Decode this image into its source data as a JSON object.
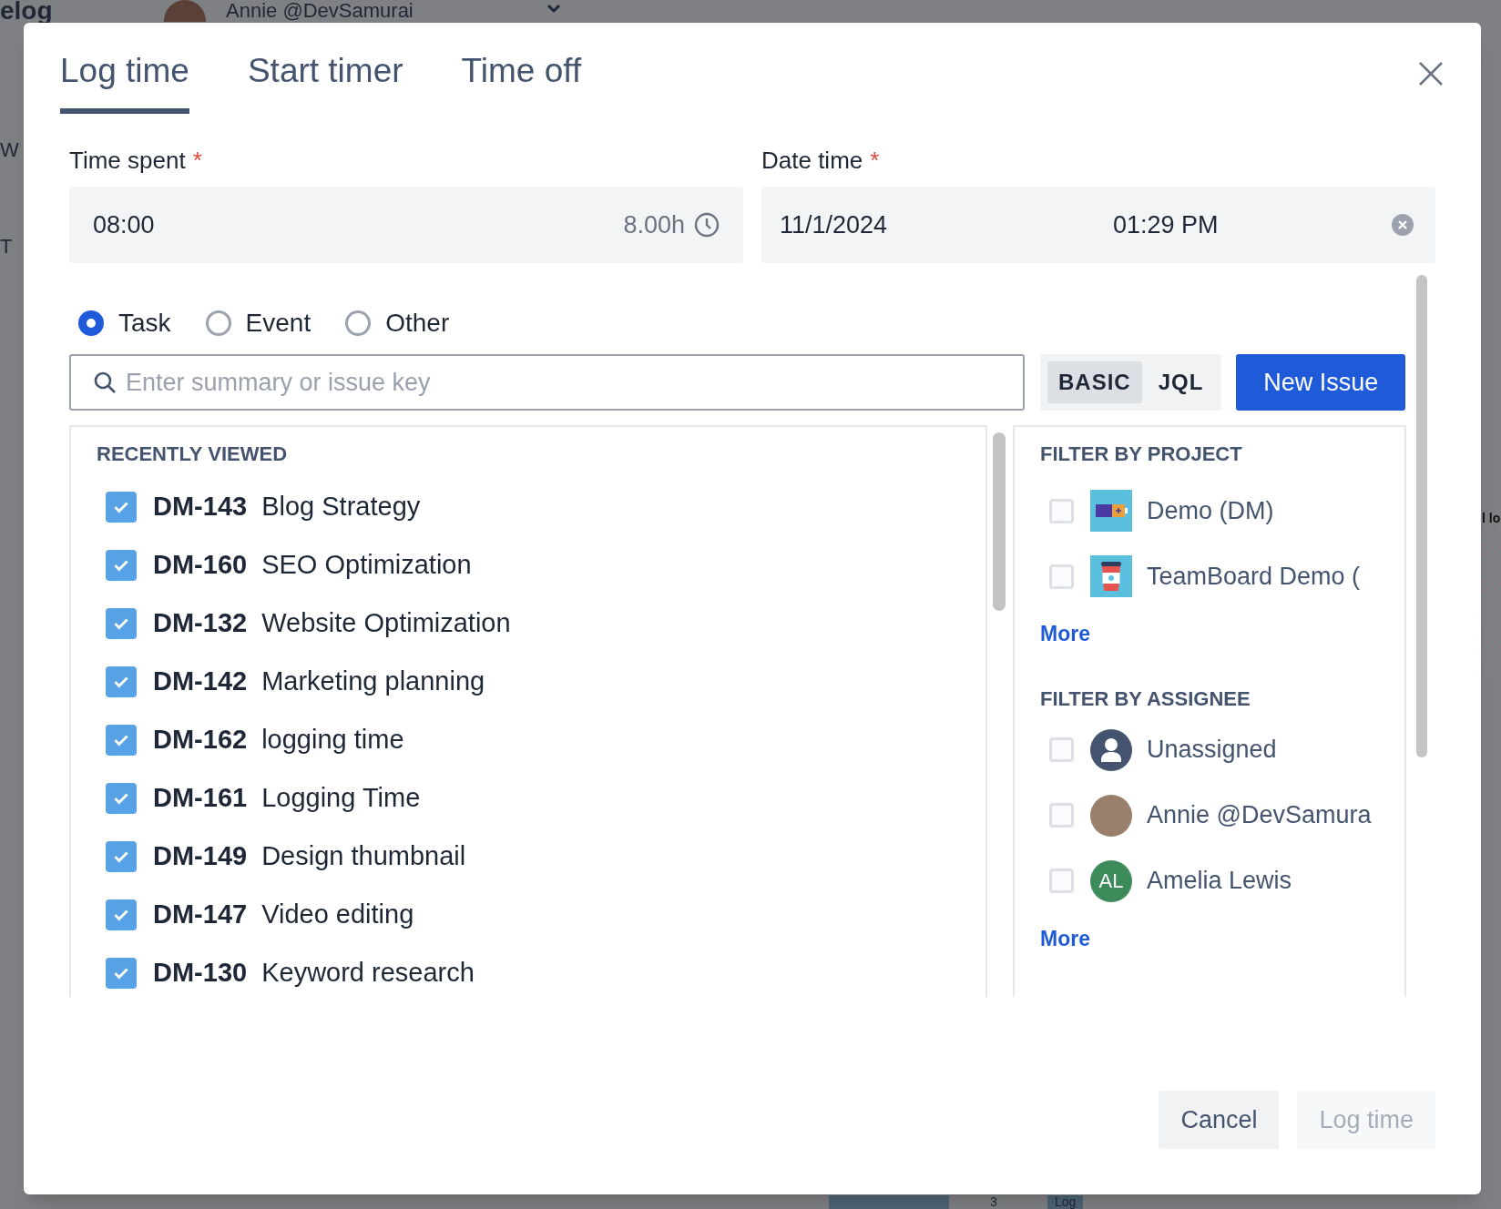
{
  "background": {
    "app_title": "elog",
    "user": "Annie @DevSamurai",
    "left_fragments": [
      "W",
      "T"
    ],
    "right_fragment": "l lo",
    "bottom_fragments": [
      "3",
      "Log"
    ]
  },
  "tabs": [
    {
      "label": "Log time",
      "selected": true
    },
    {
      "label": "Start timer",
      "selected": false
    },
    {
      "label": "Time off",
      "selected": false
    }
  ],
  "fields": {
    "time_spent": {
      "label": "Time spent",
      "required_mark": "*",
      "value": "08:00",
      "hint": "8.00h"
    },
    "date_time": {
      "label": "Date time",
      "required_mark": "*",
      "date": "11/1/2024",
      "time": "01:29 PM"
    }
  },
  "types": [
    {
      "label": "Task",
      "selected": true
    },
    {
      "label": "Event",
      "selected": false
    },
    {
      "label": "Other",
      "selected": false
    }
  ],
  "search": {
    "placeholder": "Enter summary or issue key"
  },
  "modes": [
    {
      "label": "BASIC",
      "selected": true
    },
    {
      "label": "JQL",
      "selected": false
    }
  ],
  "new_issue_button": "New Issue",
  "recently_viewed": {
    "heading": "RECENTLY VIEWED",
    "items": [
      {
        "key": "DM-143",
        "summary": "Blog Strategy",
        "checked": true
      },
      {
        "key": "DM-160",
        "summary": "SEO Optimization",
        "checked": true
      },
      {
        "key": "DM-132",
        "summary": "Website Optimization",
        "checked": true
      },
      {
        "key": "DM-142",
        "summary": "Marketing planning",
        "checked": true
      },
      {
        "key": "DM-162",
        "summary": "logging time",
        "checked": true
      },
      {
        "key": "DM-161",
        "summary": "Logging Time",
        "checked": true
      },
      {
        "key": "DM-149",
        "summary": "Design thumbnail",
        "checked": true
      },
      {
        "key": "DM-147",
        "summary": "Video editing",
        "checked": true
      },
      {
        "key": "DM-130",
        "summary": "Keyword research",
        "checked": true
      }
    ]
  },
  "filter_by_project": {
    "heading": "FILTER BY PROJECT",
    "items": [
      {
        "label": "Demo (DM)",
        "checked": false,
        "kind": "battery"
      },
      {
        "label": "TeamBoard Demo (",
        "checked": false,
        "kind": "cup"
      }
    ],
    "more": "More"
  },
  "filter_by_assignee": {
    "heading": "FILTER BY ASSIGNEE",
    "items": [
      {
        "label": "Unassigned",
        "checked": false,
        "kind": "silhouette"
      },
      {
        "label": "Annie @DevSamura",
        "checked": false,
        "kind": "photo"
      },
      {
        "label": "Amelia Lewis",
        "checked": false,
        "kind": "initials",
        "initials": "AL",
        "color": "#3d8a5b"
      }
    ],
    "more": "More"
  },
  "footer": [
    {
      "label": "Cancel",
      "disabled": false
    },
    {
      "label": "Log time",
      "disabled": true
    }
  ]
}
